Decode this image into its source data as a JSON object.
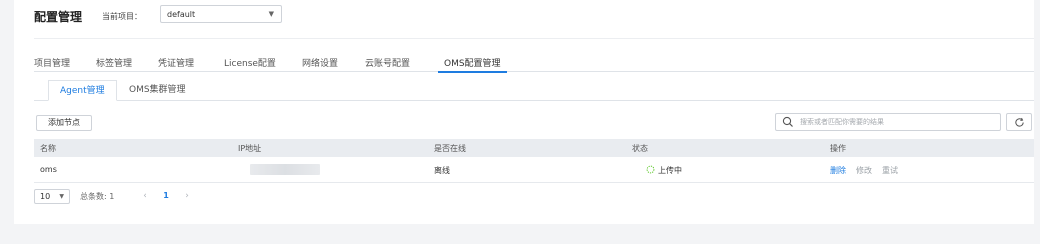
{
  "header": {
    "title": "配置管理",
    "project_label": "当前项目：",
    "project_value": "default"
  },
  "main_tabs": [
    {
      "label": "项目管理"
    },
    {
      "label": "标签管理"
    },
    {
      "label": "凭证管理"
    },
    {
      "label": "License配置"
    },
    {
      "label": "网络设置"
    },
    {
      "label": "云账号配置"
    },
    {
      "label": "OMS配置管理",
      "active": true
    }
  ],
  "sub_tabs": [
    {
      "label": "Agent管理",
      "active": true
    },
    {
      "label": "OMS集群管理"
    }
  ],
  "toolbar": {
    "add_label": "添加节点",
    "search_placeholder": "搜索或者匹配你需要的结果"
  },
  "table": {
    "columns": [
      "名称",
      "IP地址",
      "是否在线",
      "状态",
      "操作"
    ],
    "rows": [
      {
        "name": "oms",
        "ip": "",
        "online": "离线",
        "status": "上传中",
        "actions": {
          "delete": "删除",
          "edit": "修改",
          "retry": "重试"
        }
      }
    ]
  },
  "pagination": {
    "page_size": "10",
    "total_label": "总条数: 1",
    "current_page": "1"
  },
  "colors": {
    "accent": "#1e7ce0",
    "header_bg": "#e9ecf0",
    "page_bg": "#f3f4f6"
  }
}
